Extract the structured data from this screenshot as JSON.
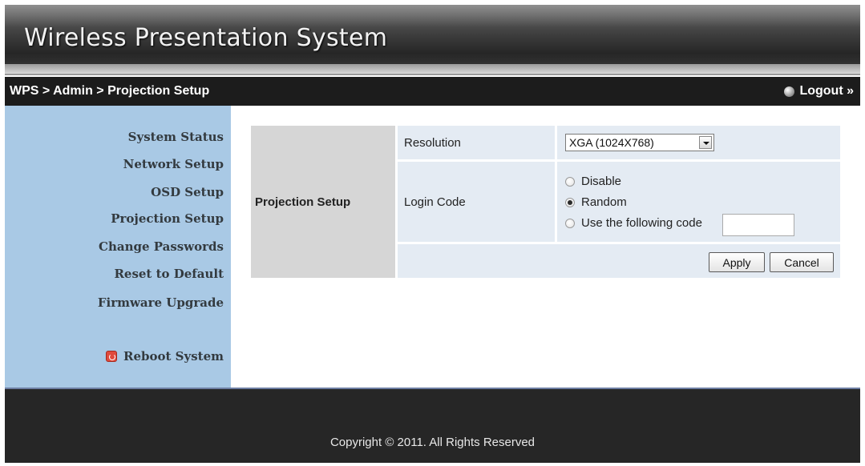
{
  "header": {
    "title": "Wireless Presentation System"
  },
  "breadcrumb": {
    "text": "WPS > Admin > Projection Setup",
    "logout_label": "Logout »"
  },
  "sidebar": {
    "items": [
      {
        "label": "System Status"
      },
      {
        "label": "Network Setup"
      },
      {
        "label": "OSD Setup"
      },
      {
        "label": "Projection Setup"
      },
      {
        "label": "Change Passwords"
      },
      {
        "label": "Reset to Default"
      },
      {
        "label": "Firmware Upgrade"
      }
    ],
    "reboot_label": "Reboot System",
    "icons": {
      "reboot": "power-icon",
      "logout": "logout-bullet-icon"
    }
  },
  "form": {
    "section_label": "Projection Setup",
    "resolution_label": "Resolution",
    "resolution_value": "XGA (1024X768)",
    "login_code_label": "Login Code",
    "options": [
      "Disable",
      "Random",
      "Use the following code"
    ],
    "selected_option": "Random",
    "code_value": "",
    "apply_label": "Apply",
    "cancel_label": "Cancel"
  },
  "footer": {
    "copyright": "Copyright © 2011. All Rights Reserved"
  },
  "colors": {
    "sidebar_bg": "#a9c9e5",
    "form_row_bg": "#e4ebf3",
    "section_label_bg": "#d6d6d6",
    "header_dark": "#1c1c1c"
  }
}
